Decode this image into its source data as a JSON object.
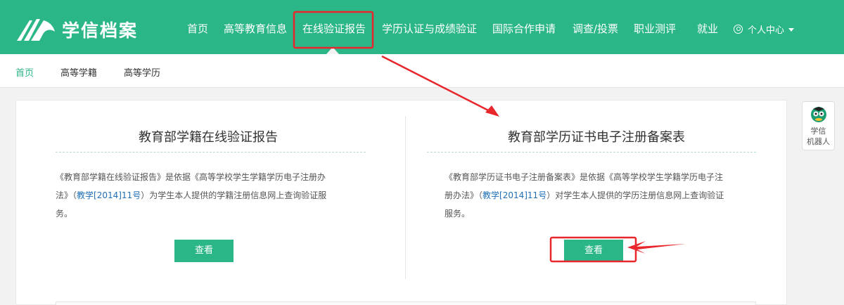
{
  "brand": {
    "name": "学信档案"
  },
  "nav": {
    "items": [
      {
        "label": "首页"
      },
      {
        "label": "高等教育信息"
      },
      {
        "label": "在线验证报告"
      },
      {
        "label": "学历认证与成绩验证"
      },
      {
        "label": "国际合作申请"
      },
      {
        "label": "调查/投票"
      },
      {
        "label": "职业测评"
      },
      {
        "label": "就业"
      }
    ],
    "user_center": "个人中心"
  },
  "subnav": {
    "items": [
      {
        "label": "首页"
      },
      {
        "label": "高等学籍"
      },
      {
        "label": "高等学历"
      }
    ]
  },
  "cards": [
    {
      "title": "教育部学籍在线验证报告",
      "desc_1": "《教育部学籍在线验证报告》是依据《高等学校学生学籍学历电子注册办",
      "desc_2_pre": "法》（",
      "desc_2_link": "教学[2014]11号",
      "desc_2_post": "）为学生本人提供的学籍注册信息网上查询验证服",
      "desc_3": "务。",
      "button": "查看"
    },
    {
      "title": "教育部学历证书电子注册备案表",
      "desc_1": "《教育部学历证书电子注册备案表》是依据《高等学校学生学籍学历电子注",
      "desc_2_pre": "册办法》（",
      "desc_2_link": "教学[2014]11号",
      "desc_2_post": "）对学生本人提供的学历注册信息网上查询验证",
      "desc_3": "服务。",
      "button": "查看"
    }
  ],
  "robot": {
    "line1": "学信",
    "line2": "机器人"
  },
  "colors": {
    "brand_green": "#2bb688",
    "annotation_red": "#e8262c",
    "link_blue": "#1f6fb7"
  }
}
